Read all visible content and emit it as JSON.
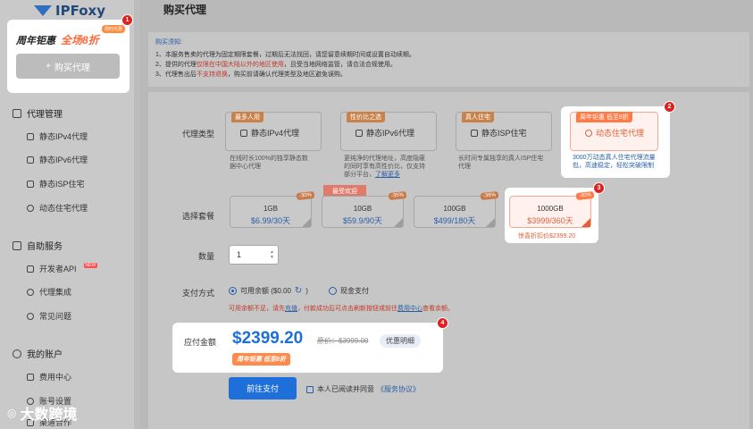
{
  "brand": {
    "name": "IPFoxy"
  },
  "sidebar": {
    "promo": {
      "left": "周年钜惠",
      "right": "全场8折",
      "tag": "限时优惠"
    },
    "buy_button": "购买代理",
    "groups": [
      {
        "label": "代理管理",
        "items": [
          "静态IPv4代理",
          "静态IPv6代理",
          "静态ISP住宅",
          "动态住宅代理"
        ]
      },
      {
        "label": "自助服务",
        "items": [
          "开发者API",
          "代理集成",
          "常见问题"
        ],
        "badge": "NEW"
      },
      {
        "label": "我的账户",
        "items": [
          "费用中心",
          "账号设置",
          "渠道合作"
        ]
      }
    ]
  },
  "page": {
    "title": "购买代理"
  },
  "notice": {
    "title": "购买须知:",
    "line1": "1、本服务售卖的代理为固定期限套餐，过期后无法找回，请您留意续期时间或设置自动续期。",
    "line2_pre": "2、提供的代理",
    "line2_red": "仅限在中国大陆以外的地区使用",
    "line2_post": "，且受当地网络监管，请合法合规使用。",
    "line3_pre": "3、代理售出后",
    "line3_red": "不支持退换",
    "line3_post": "，购买前请确认代理类型及地区避免误购。"
  },
  "proxy_type": {
    "label": "代理类型",
    "options": [
      {
        "tag": "最多人用",
        "title": "静态IPv4代理",
        "desc1": "在线时长100%的独享静态数",
        "desc2": "据中心代理"
      },
      {
        "tag": "性价比之选",
        "title": "静态IPv6代理",
        "desc1": "更纯净的代理地址，高度隐蔽",
        "desc2": "的同时享有高性价比，仅支持",
        "desc3": "部分平台，",
        "link": "了解更多"
      },
      {
        "tag": "真人住宅",
        "title": "静态ISP住宅",
        "desc1": "长时间专属独享的真人ISP住宅",
        "desc2": "代理"
      },
      {
        "tag": "周年钜惠 低至8折",
        "title": "动态住宅代理",
        "desc1": "3000万动态真人住宅代理流量",
        "desc2": "包，高速稳定，轻松突破限制"
      }
    ]
  },
  "package": {
    "label": "选择套餐",
    "hot": "最受欢迎",
    "options": [
      {
        "size": "1GB",
        "price": "$6.99/30天",
        "ribbon": "-30%"
      },
      {
        "size": "10GB",
        "price": "$59.9/90天",
        "ribbon": "-35%"
      },
      {
        "size": "100GB",
        "price": "$499/180天",
        "ribbon": "-36%"
      },
      {
        "size": "1000GB",
        "price": "$3999/360天",
        "ribbon": "-40%"
      }
    ],
    "discount_note": "惊喜折扣价$2399.20"
  },
  "quantity": {
    "label": "数量",
    "value": "1"
  },
  "payment": {
    "label": "支付方式",
    "balance": "可用余额 ($0.00",
    "cash": "现金支付",
    "warn_pre": "可用余额不足，请先",
    "warn_link": "充值",
    "warn_mid": "，付款成功后可点击刷新按钮或前往",
    "warn_link2": "费用中心",
    "warn_post": "查看余额。"
  },
  "total": {
    "label": "应付金额",
    "amount": "$2399.20",
    "original": "原价：$3999.00",
    "detail": "优惠明细",
    "promo": "周年钜惠 低至8折"
  },
  "actions": {
    "pay": "前往支付",
    "agree_pre": "本人已阅读并同意",
    "agree_link": "《服务协议》"
  },
  "callouts": [
    "1",
    "2",
    "3",
    "4"
  ],
  "watermark": "大数跨境"
}
